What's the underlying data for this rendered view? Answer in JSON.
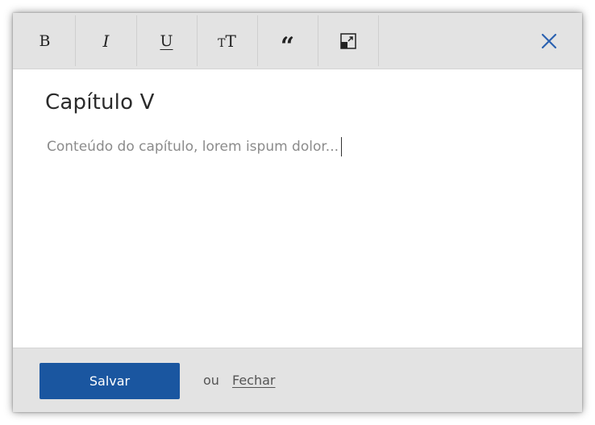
{
  "toolbar": {
    "buttons": [
      {
        "id": "bold",
        "label": "B"
      },
      {
        "id": "italic",
        "label": "I"
      },
      {
        "id": "underline",
        "label": "U"
      },
      {
        "id": "text_size",
        "small": "T",
        "large": "T"
      },
      {
        "id": "quote",
        "label": "“"
      },
      {
        "id": "expand",
        "icon": "expand-icon"
      }
    ],
    "close_icon": "close-icon"
  },
  "editor": {
    "title": "Capítulo V",
    "body": "Conteúdo do capítulo, lorem ispum dolor..."
  },
  "footer": {
    "save_label": "Salvar",
    "or_label": "ou",
    "close_label": "Fechar"
  },
  "colors": {
    "accent": "#1a56a0",
    "toolbar_bg": "#e3e3e3",
    "close_icon": "#2c62b0"
  }
}
